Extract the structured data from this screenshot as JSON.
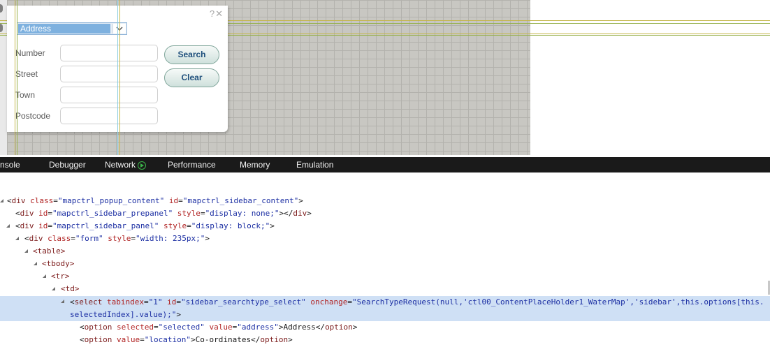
{
  "popup": {
    "help": "?",
    "close": "✕",
    "search_type": "Address",
    "fields": [
      {
        "label": "Number"
      },
      {
        "label": "Street"
      },
      {
        "label": "Town"
      },
      {
        "label": "Postcode"
      }
    ],
    "search_label": "Search",
    "clear_label": "Clear"
  },
  "devtools": {
    "tabs": [
      "nsole",
      "Debugger",
      "Network",
      "Performance",
      "Memory",
      "Emulation"
    ]
  },
  "dom": {
    "l1": {
      "p1": "<",
      "tag": "div",
      "a1": " class",
      "v1": "\"mapctrl_popup_content\"",
      "a2": " id",
      "v2": "\"mapctrl_sidebar_content\"",
      "end": ">"
    },
    "l2": {
      "p1": "<",
      "tag": "div",
      "a1": " id",
      "v1": "\"mapctrl_sidebar_prepanel\"",
      "a2": " style",
      "v2": "\"display: none;\"",
      "end": "></",
      "tag2": "div",
      "end2": ">"
    },
    "l3": {
      "p1": "<",
      "tag": "div",
      "a1": " id",
      "v1": "\"mapctrl_sidebar_panel\"",
      "a2": " style",
      "v2": "\"display: block;\"",
      "end": ">"
    },
    "l4": {
      "p1": "<",
      "tag": "div",
      "a1": " class",
      "v1": "\"form\"",
      "a2": " style",
      "v2": "\"width: 235px;\"",
      "end": ">"
    },
    "l5": "<table>",
    "l6": "<tbody>",
    "l7": "<tr>",
    "l8": "<td>",
    "l9": {
      "p1": "<",
      "tag": "select",
      "a1": " tabindex",
      "v1": "\"1\"",
      "a2": " id",
      "v2": "\"sidebar_searchtype_select\"",
      "a3": " onchange",
      "v3": "\"SearchTypeRequest(null,'ctl00_ContentPlaceHolder1_WaterMap','sidebar',this.options[this.",
      "cont": "selectedIndex].value);\"",
      "end": ">"
    },
    "l10": {
      "p1": "<",
      "tag": "option",
      "a1": " selected",
      "v1": "\"selected\"",
      "a2": " value",
      "v2": "\"address\"",
      "text": ">Address</",
      "tag2": "option",
      "end": ">"
    },
    "l11": {
      "p1": "<",
      "tag": "option",
      "a1": " value",
      "v1": "\"location\"",
      "text": ">Co-ordinates</",
      "tag2": "option",
      "end": ">"
    }
  },
  "colors": {
    "map_grid": "#c8c7c2",
    "guide_gold": "#c4b64a",
    "guide_olive": "#95b04a",
    "guide_cyan": "#8ccfe0",
    "select_highlight": "#7eb1df",
    "button_text": "#1e4f7c",
    "devtools_bar": "#1a1a1a",
    "selected_row": "#cfe0f5"
  },
  "icons": [
    "help-icon",
    "close-icon",
    "chevron-down-icon",
    "network-recording-icon",
    "expand-triangle-icon"
  ]
}
